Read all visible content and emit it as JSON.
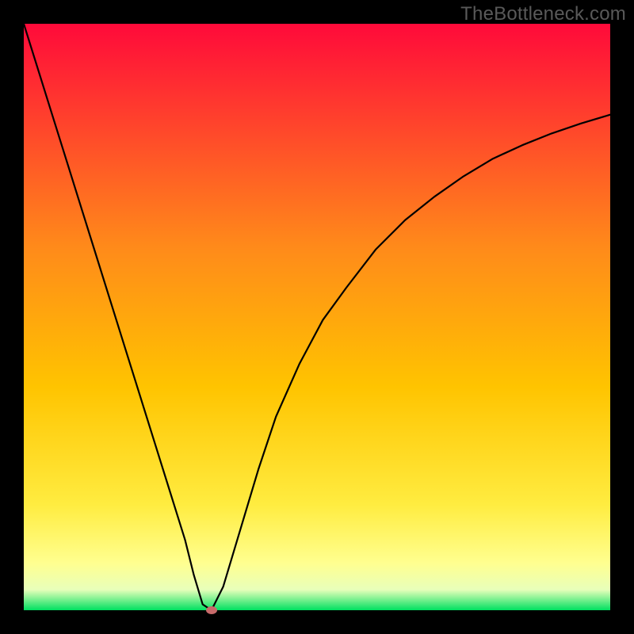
{
  "watermark": "TheBottleneck.com",
  "chart_data": {
    "type": "line",
    "title": "",
    "xlabel": "",
    "ylabel": "",
    "xlim": [
      0,
      100
    ],
    "ylim": [
      0,
      100
    ],
    "background_gradient": {
      "top_color": "#ff0a3a",
      "mid_color": "#ffc400",
      "lower_color": "#ffff70",
      "bottom_color": "#00e060"
    },
    "series": [
      {
        "name": "bottleneck-curve",
        "color": "#000000",
        "x": [
          0.0,
          2.5,
          5.0,
          7.5,
          10.0,
          12.5,
          15.0,
          17.5,
          20.0,
          22.5,
          25.0,
          27.5,
          29.0,
          30.5,
          32.0,
          34.0,
          37.0,
          40.0,
          43.0,
          47.0,
          51.0,
          55.0,
          60.0,
          65.0,
          70.0,
          75.0,
          80.0,
          85.0,
          90.0,
          95.0,
          100.0
        ],
        "y": [
          100.0,
          92.0,
          84.0,
          76.0,
          68.0,
          60.0,
          52.0,
          44.0,
          36.0,
          28.0,
          20.0,
          12.0,
          6.0,
          1.0,
          0.0,
          4.0,
          14.0,
          24.0,
          33.0,
          42.0,
          49.5,
          55.0,
          61.5,
          66.5,
          70.5,
          74.0,
          77.0,
          79.3,
          81.3,
          83.0,
          84.5
        ]
      }
    ],
    "marker": {
      "name": "optimal-point",
      "x": 32.0,
      "y": 0.0,
      "color": "#c76a6a"
    }
  }
}
